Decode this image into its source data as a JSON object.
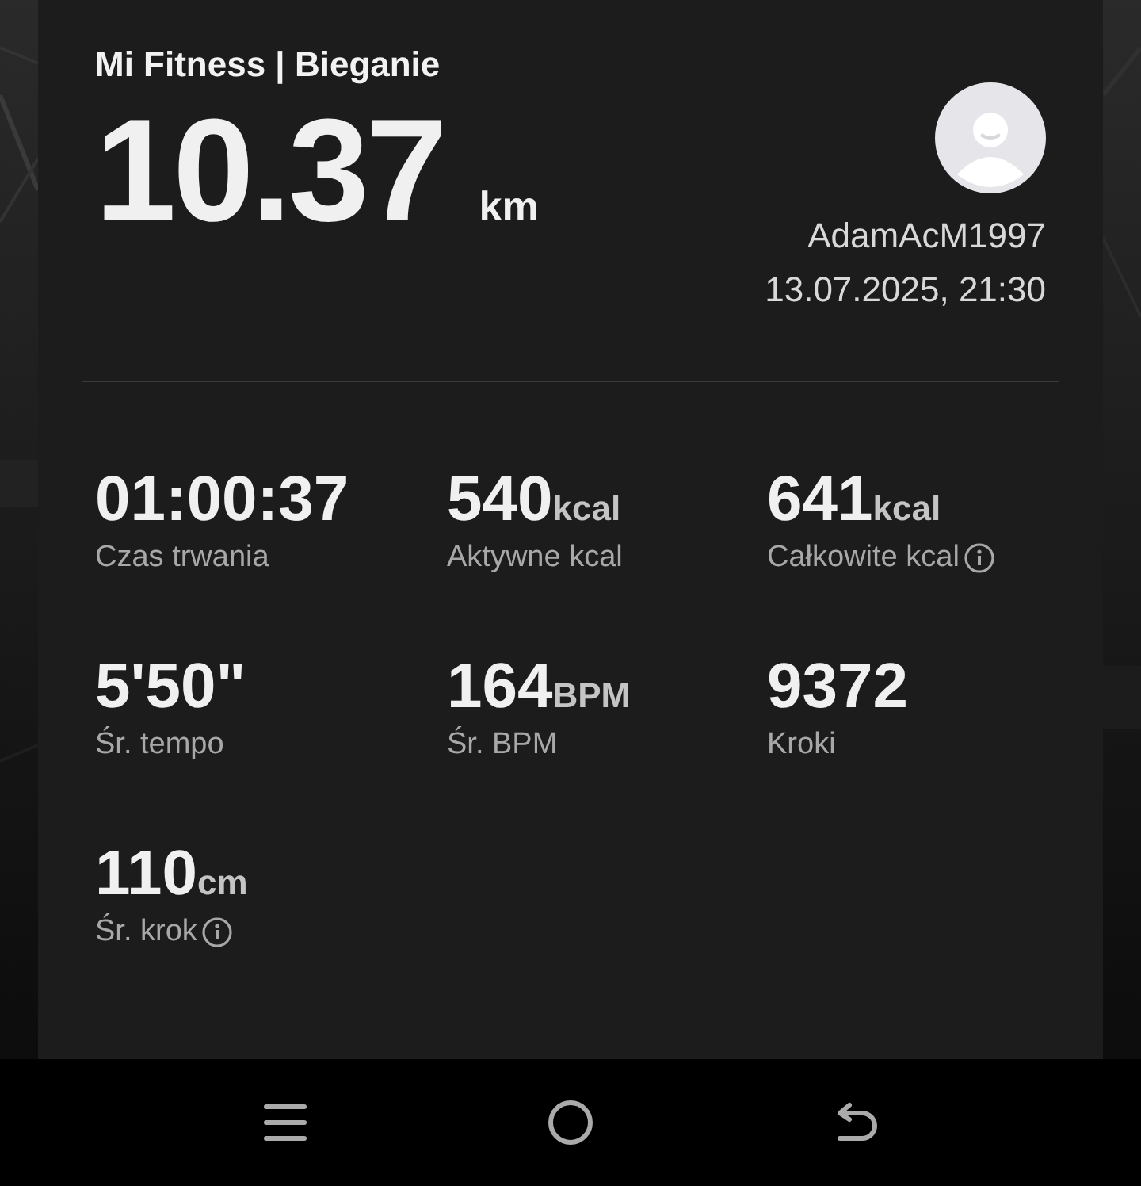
{
  "card": {
    "title": "Mi Fitness | Bieganie",
    "distance": {
      "value": "10.37",
      "unit": "km"
    },
    "user": {
      "name": "AdamAcM1997",
      "datetime": "13.07.2025, 21:30"
    }
  },
  "stats": [
    {
      "value": "01:00:37",
      "label": "Czas trwania",
      "info": false
    },
    {
      "value": "540",
      "unit": "kcal",
      "label": "Aktywne kcal",
      "info": false
    },
    {
      "value": "641",
      "unit": "kcal",
      "label": "Całkowite kcal",
      "info": true
    },
    {
      "value": "5'50\"",
      "label": "Śr. tempo",
      "info": false
    },
    {
      "value": "164",
      "unit": "BPM",
      "label": "Śr. BPM",
      "info": false
    },
    {
      "value": "9372",
      "label": "Kroki",
      "info": false
    },
    {
      "value": "110",
      "unit": "cm",
      "label": "Śr. krok",
      "info": true
    }
  ]
}
